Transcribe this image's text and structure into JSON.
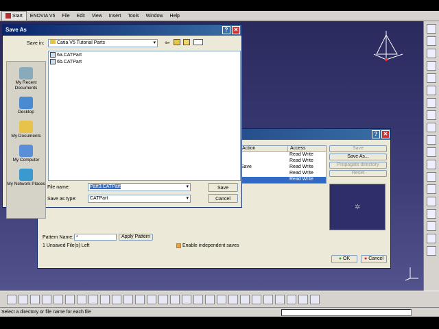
{
  "menu": [
    "Start",
    "ENOVIA V5",
    "File",
    "Edit",
    "View",
    "Insert",
    "Tools",
    "Window",
    "Help"
  ],
  "save_as": {
    "title": "Save As",
    "save_in_label": "Save in:",
    "save_in_value": "Catia V5 Tutorial Parts",
    "places": [
      "My Recent Documents",
      "Desktop",
      "My Documents",
      "My Computer",
      "My Network Places"
    ],
    "files": [
      "6a.CATPart",
      "6b.CATPart"
    ],
    "file_name_label": "File name:",
    "file_name_value": "Part3.CATPart",
    "save_as_type_label": "Save as type:",
    "save_as_type_value": "CATPart",
    "save_btn": "Save",
    "cancel_btn": "Cancel"
  },
  "save_mgmt": {
    "col_action": "Action",
    "col_access": "Access",
    "rows": [
      {
        "action": "",
        "access": "Read Write"
      },
      {
        "action": "",
        "access": "Read Write"
      },
      {
        "action": "Save",
        "access": "Read Write"
      },
      {
        "action": "",
        "access": "Read Write"
      },
      {
        "action": "",
        "access": "Read Write"
      }
    ],
    "side_buttons": [
      "Save",
      "Save As...",
      "Propagate directory",
      "Reset"
    ],
    "pattern_label": "Pattern Name:",
    "pattern_value": "*",
    "apply_btn": "Apply Pattern",
    "unsaved": "1 Unsaved File(s) Left",
    "independent": "Enable independent saves",
    "ok": "OK",
    "cancel": "Cancel"
  },
  "status_text": "Select a directory or file name for each file",
  "icons": [
    "folder-icon",
    "back-arrow-icon",
    "up-folder-icon",
    "new-folder-icon",
    "views-icon"
  ]
}
